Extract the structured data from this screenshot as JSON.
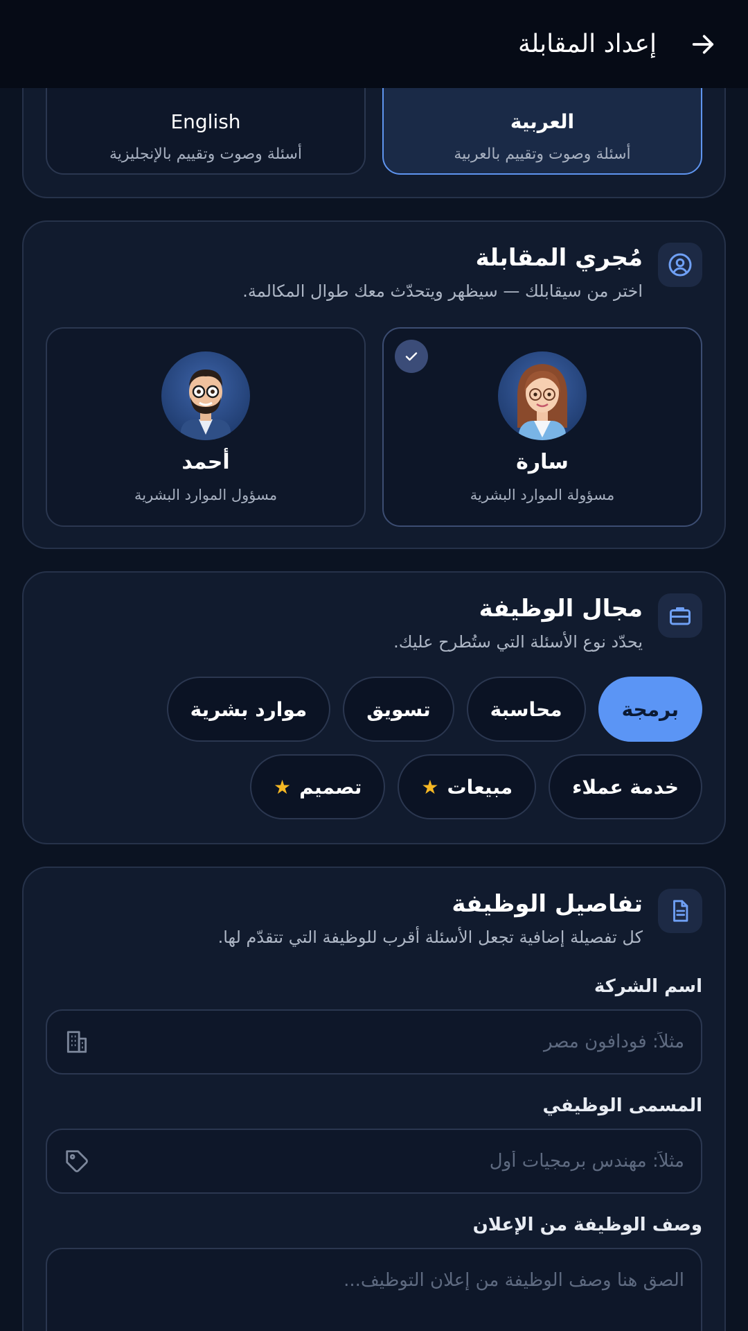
{
  "appbar": {
    "title": "إعداد المقابلة"
  },
  "language": {
    "options": [
      {
        "title": "العربية",
        "subtitle": "أسئلة وصوت وتقييم بالعربية",
        "selected": true
      },
      {
        "title": "English",
        "subtitle": "أسئلة وصوت وتقييم بالإنجليزية",
        "selected": false
      }
    ]
  },
  "interviewer": {
    "title": "مُجري المقابلة",
    "subtitle": "اختر من سيقابلك — سيظهر ويتحدّث معك طوال المكالمة.",
    "people": [
      {
        "name": "سارة",
        "role": "مسؤولة الموارد البشرية",
        "selected": true
      },
      {
        "name": "أحمد",
        "role": "مسؤول الموارد البشرية",
        "selected": false
      }
    ]
  },
  "job_field": {
    "title": "مجال الوظيفة",
    "subtitle": "يحدّد نوع الأسئلة التي ستُطرح عليك.",
    "chips": [
      {
        "label": "برمجة",
        "active": true
      },
      {
        "label": "محاسبة",
        "active": false
      },
      {
        "label": "تسويق",
        "active": false
      },
      {
        "label": "موارد بشرية",
        "active": false
      },
      {
        "label": "خدمة عملاء",
        "active": false
      },
      {
        "label": "مبيعات",
        "active": false,
        "starred": true
      },
      {
        "label": "تصميم",
        "active": false,
        "starred": true
      }
    ]
  },
  "job_details": {
    "title": "تفاصيل الوظيفة",
    "subtitle": "كل تفصيلة إضافية تجعل الأسئلة أقرب للوظيفة التي تتقدّم لها.",
    "company_label": "اسم الشركة",
    "company_placeholder": "مثلاً: فودافون مصر",
    "jobtitle_label": "المسمى الوظيفي",
    "jobtitle_placeholder": "مثلاً: مهندس برمجيات أول",
    "description_label": "وصف الوظيفة من الإعلان",
    "description_placeholder": "الصق هنا وصف الوظيفة من إعلان التوظيف..."
  },
  "colors": {
    "accent": "#5b95f5",
    "background": "#0b1322",
    "card": "#111b2e",
    "star": "#f6b824"
  }
}
